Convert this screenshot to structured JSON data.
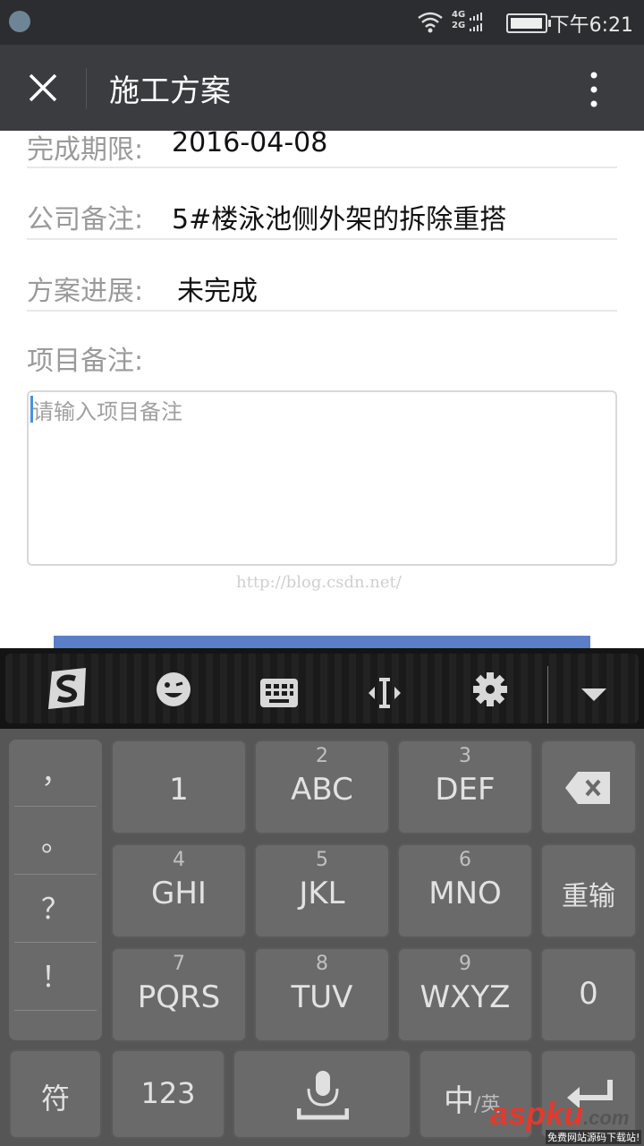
{
  "status_bar": {
    "time": "下午6:21",
    "network_top": "4G",
    "network_bottom": "2G",
    "icons": [
      "app-notification-icon",
      "wifi-icon",
      "signal-icon",
      "battery-icon"
    ]
  },
  "title_bar": {
    "title": "施工方案",
    "close_icon": "close-icon",
    "menu_icon": "more-vertical-icon"
  },
  "form": {
    "rows": [
      {
        "label": "完成期限:",
        "value": "2016-04-08"
      },
      {
        "label": "公司备注:",
        "value": "5#楼泳池侧外架的拆除重搭"
      },
      {
        "label": "方案进展:",
        "value": "未完成"
      }
    ],
    "remark_label": "项目备注:",
    "remark_placeholder": "请输入项目备注"
  },
  "watermark": "http://blog.csdn.net/",
  "keyboard": {
    "toolbar": [
      "sogou-logo-icon",
      "emoji-icon",
      "keyboard-icon",
      "cursor-move-icon",
      "settings-icon",
      "collapse-keyboard-icon"
    ],
    "punctuation": [
      "，",
      "。",
      "？",
      "！"
    ],
    "keys": [
      {
        "num": "",
        "label": "1"
      },
      {
        "num": "2",
        "label": "ABC"
      },
      {
        "num": "3",
        "label": "DEF"
      },
      {
        "num": "4",
        "label": "GHI"
      },
      {
        "num": "5",
        "label": "JKL"
      },
      {
        "num": "6",
        "label": "MNO"
      },
      {
        "num": "7",
        "label": "PQRS"
      },
      {
        "num": "8",
        "label": "TUV"
      },
      {
        "num": "9",
        "label": "WXYZ"
      }
    ],
    "delete_icon": "backspace-icon",
    "retype": "重输",
    "zero": "0",
    "symbols": "符",
    "numbers": "123",
    "mic_icon": "microphone-icon",
    "lang_zh": "中",
    "lang_en": "/英",
    "enter_icon": "enter-icon"
  },
  "site_watermark": {
    "brand_asp": "asp",
    "brand_ku": "ku",
    "brand_com": ".com",
    "slogan": "免费网站源码下载站!"
  },
  "colors": {
    "title_bar": "#3a3c40",
    "accent_button": "#5b7fc7",
    "keyboard_bg": "#565656"
  }
}
